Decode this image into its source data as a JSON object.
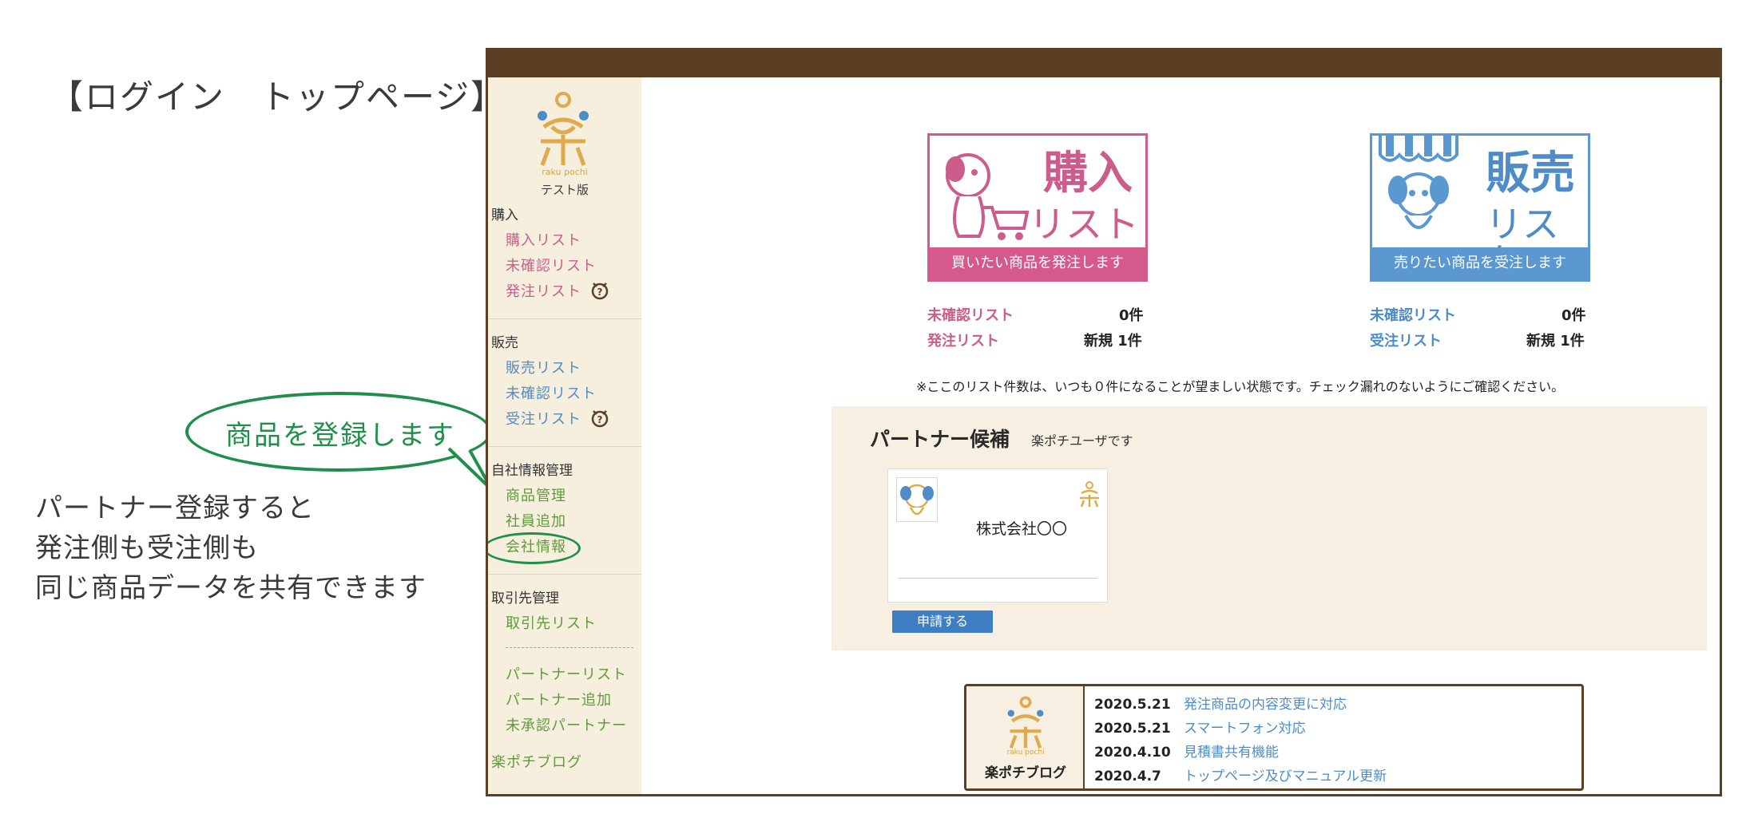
{
  "annotation": {
    "heading": "【ログイン　トップページ】",
    "bubble": "商品を登録します",
    "description": [
      "パートナー登録すると",
      "発注側も受注側も",
      "同じ商品データを共有できます"
    ]
  },
  "sidebar": {
    "logo_sub": "raku pochi",
    "logo_test": "テスト版",
    "sections": [
      {
        "title": "購入",
        "items": [
          "購入リスト",
          "未確認リスト",
          "発注リスト"
        ]
      },
      {
        "title": "販売",
        "items": [
          "販売リスト",
          "未確認リスト",
          "受注リスト"
        ]
      },
      {
        "title": "自社情報管理",
        "items": [
          "商品管理",
          "社員追加",
          "会社情報"
        ]
      },
      {
        "title": "取引先管理",
        "items": [
          "取引先リスト",
          "パートナーリスト",
          "パートナー追加",
          "未承認パートナー"
        ]
      }
    ],
    "blog_link": "楽ポチブログ"
  },
  "cards": {
    "purchase": {
      "big": "購入",
      "mid": "リスト",
      "foot": "買いたい商品を発注します",
      "stats": [
        {
          "label": "未確認リスト",
          "value": "0件"
        },
        {
          "label": "発注リスト",
          "value": "新規 1件"
        }
      ]
    },
    "sales": {
      "big": "販売",
      "mid": "リスト",
      "foot": "売りたい商品を受注します",
      "stats": [
        {
          "label": "未確認リスト",
          "value": "0件"
        },
        {
          "label": "受注リスト",
          "value": "新規 1件"
        }
      ]
    }
  },
  "note": "※ここのリスト件数は、いつも０件になることが望ましい状態です。チェック漏れのないようにご確認ください。",
  "partner": {
    "title": "パートナー候補",
    "subtitle": "楽ポチユーザです",
    "company": "株式会社〇〇",
    "apply_label": "申請する"
  },
  "blog": {
    "label": "楽ポチブログ",
    "logo_sub": "raku pochi",
    "news": [
      {
        "date": "2020.5.21",
        "text": "発注商品の内容変更に対応"
      },
      {
        "date": "2020.5.21",
        "text": "スマートフォン対応"
      },
      {
        "date": "2020.4.10",
        "text": "見積書共有機能"
      },
      {
        "date": "2020.4.7",
        "text": "トップページ及びマニュアル更新"
      }
    ]
  },
  "colors": {
    "brown": "#5a3f24",
    "pink": "#cc5c8b",
    "blue": "#4e8cc8",
    "green": "#5e9a3a",
    "annotation_green": "#1f8f4a"
  }
}
